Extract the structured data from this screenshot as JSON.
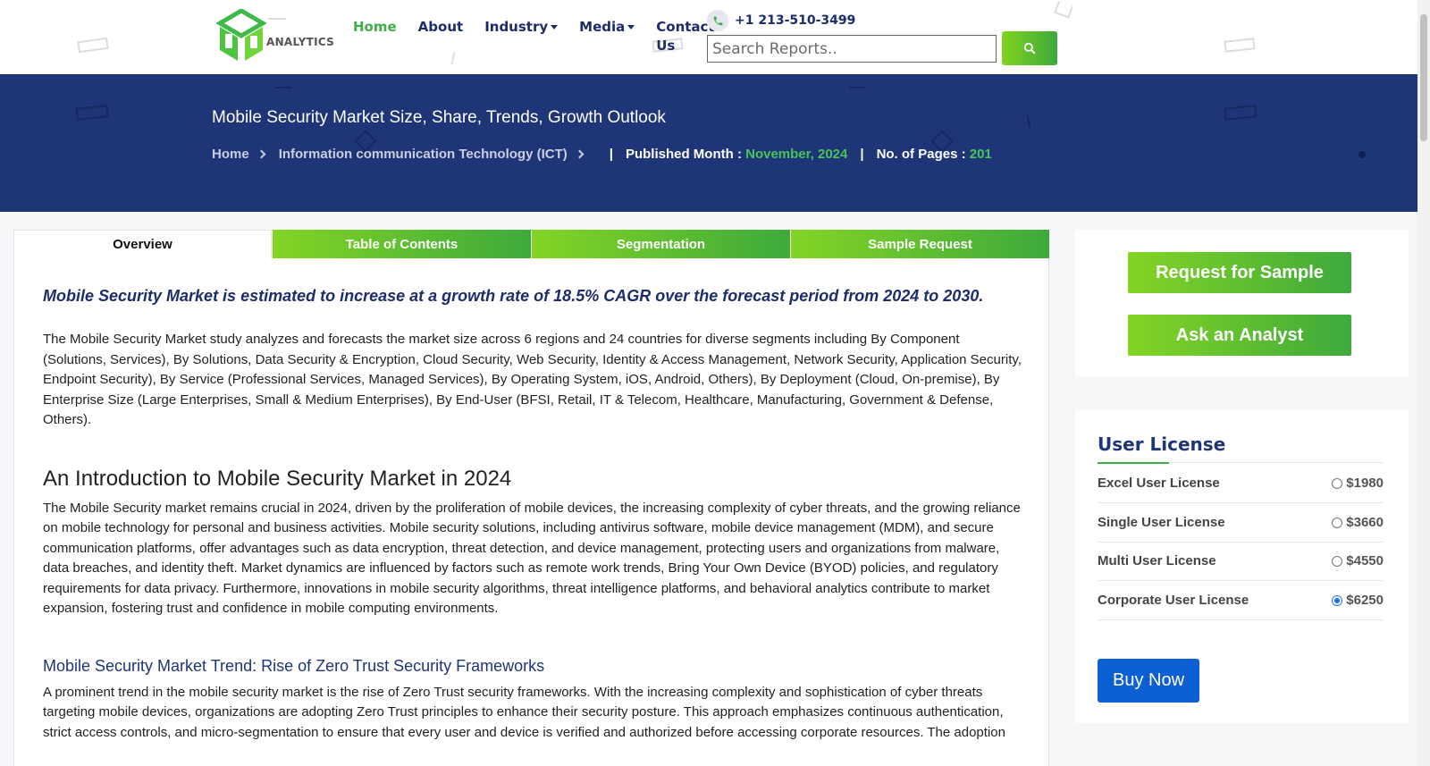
{
  "header": {
    "logo_text": "ANALYTICS",
    "nav": [
      {
        "label": "Home",
        "active": true,
        "dropdown": false
      },
      {
        "label": "About",
        "active": false,
        "dropdown": false
      },
      {
        "label": "Industry",
        "active": false,
        "dropdown": true
      },
      {
        "label": "Media",
        "active": false,
        "dropdown": true
      },
      {
        "label": "Contact Us",
        "active": false,
        "dropdown": false
      }
    ],
    "phone": "+1 213-510-3499",
    "search_placeholder": "Search Reports.."
  },
  "banner": {
    "title": "Mobile Security Market Size, Share, Trends, Growth Outlook",
    "breadcrumb": [
      "Home",
      "Information communication Technology (ICT)"
    ],
    "published_label": "Published Month :",
    "published_value": "November, 2024",
    "pages_label": "No. of Pages :",
    "pages_value": "201"
  },
  "tabs": [
    {
      "label": "Overview",
      "active": true
    },
    {
      "label": "Table of Contents",
      "active": false
    },
    {
      "label": "Segmentation",
      "active": false
    },
    {
      "label": "Sample Request",
      "active": false
    }
  ],
  "content": {
    "lead": "Mobile Security Market is estimated to increase at a growth rate of 18.5% CAGR over the forecast period from 2024 to 2030.",
    "para1": "The Mobile Security Market study analyzes and forecasts the market size across 6 regions and 24 countries for diverse segments including By Component (Solutions, Services), By Solutions, Data Security & Encryption, Cloud Security, Web Security, Identity & Access Management, Network Security, Application Security, Endpoint Security), By Service (Professional Services, Managed Services), By Operating System, iOS, Android, Others), By Deployment (Cloud, On-premise), By Enterprise Size (Large Enterprises, Small & Medium Enterprises), By End-User (BFSI, Retail, IT & Telecom, Healthcare, Manufacturing, Government & Defense, Others).",
    "h2": "An Introduction to Mobile Security Market in 2024",
    "para2": "The Mobile Security market remains crucial in 2024, driven by the proliferation of mobile devices, the increasing complexity of cyber threats, and the growing reliance on mobile technology for personal and business activities. Mobile security solutions, including antivirus software, mobile device management (MDM), and secure communication platforms, offer advantages such as data encryption, threat detection, and device management, protecting users and organizations from malware, data breaches, and identity theft. Market dynamics are influenced by factors such as remote work trends, Bring Your Own Device (BYOD) policies, and regulatory requirements for data privacy. Furthermore, innovations in mobile security algorithms, threat intelligence platforms, and behavioral analytics contribute to market expansion, fostering trust and confidence in mobile computing environments.",
    "h3": "Mobile Security Market Trend: Rise of Zero Trust Security Frameworks",
    "para3": "A prominent trend in the mobile security market is the rise of Zero Trust security frameworks. With the increasing complexity and sophistication of cyber threats targeting mobile devices, organizations are adopting Zero Trust principles to enhance their security posture. This approach emphasizes continuous authentication, strict access controls, and micro-segmentation to ensure that every user and device is verified and authorized before accessing corporate resources. The adoption"
  },
  "sidebar": {
    "request_sample": "Request for Sample",
    "ask_analyst": "Ask an Analyst",
    "license_title": "User License",
    "licenses": [
      {
        "name": "Excel User License",
        "price": "$1980",
        "selected": false
      },
      {
        "name": "Single User License",
        "price": "$3660",
        "selected": false
      },
      {
        "name": "Multi User License",
        "price": "$4550",
        "selected": false
      },
      {
        "name": "Corporate User License",
        "price": "$6250",
        "selected": true
      }
    ],
    "buy_now": "Buy Now"
  },
  "colors": {
    "navy": "#1e3577",
    "green": "#3fae49",
    "buy_blue": "#0d5fd4"
  }
}
